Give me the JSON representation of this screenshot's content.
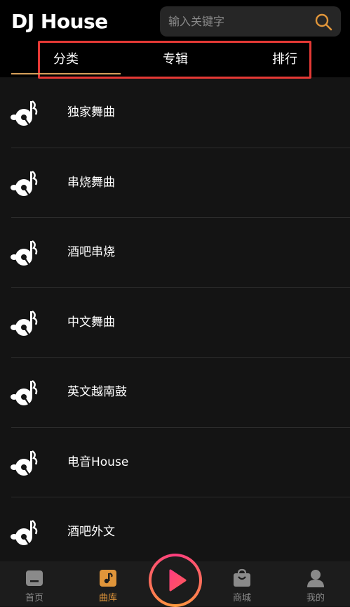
{
  "app": {
    "logo_text": "DJ House"
  },
  "search": {
    "placeholder": "输入关键字"
  },
  "tabs": [
    {
      "label": "分类",
      "active": true
    },
    {
      "label": "专辑",
      "active": false
    },
    {
      "label": "排行",
      "active": false
    }
  ],
  "categories": [
    {
      "label": "独家舞曲",
      "icon": "music-note-disc-icon"
    },
    {
      "label": "串烧舞曲",
      "icon": "music-note-disc-icon"
    },
    {
      "label": "酒吧串烧",
      "icon": "music-note-disc-icon"
    },
    {
      "label": "中文舞曲",
      "icon": "music-note-disc-icon"
    },
    {
      "label": "英文越南鼓",
      "icon": "music-note-disc-icon"
    },
    {
      "label": "电音House",
      "icon": "music-note-disc-icon"
    },
    {
      "label": "酒吧外文",
      "icon": "music-note-disc-icon"
    }
  ],
  "bottom_nav": [
    {
      "label": "首页",
      "icon": "home-icon",
      "active": false
    },
    {
      "label": "曲库",
      "icon": "music-library-icon",
      "active": true
    },
    {
      "label": "",
      "icon": "play-icon",
      "active": false
    },
    {
      "label": "商城",
      "icon": "shop-bag-icon",
      "active": false
    },
    {
      "label": "我的",
      "icon": "user-icon",
      "active": false
    }
  ],
  "colors": {
    "background": "#141414",
    "header": "#000000",
    "accent": "#e0953a",
    "highlight_box": "#e53935",
    "search_bg": "#262626",
    "play_gradient_start": "#ff3d7f",
    "play_gradient_end": "#ff9a3c"
  }
}
